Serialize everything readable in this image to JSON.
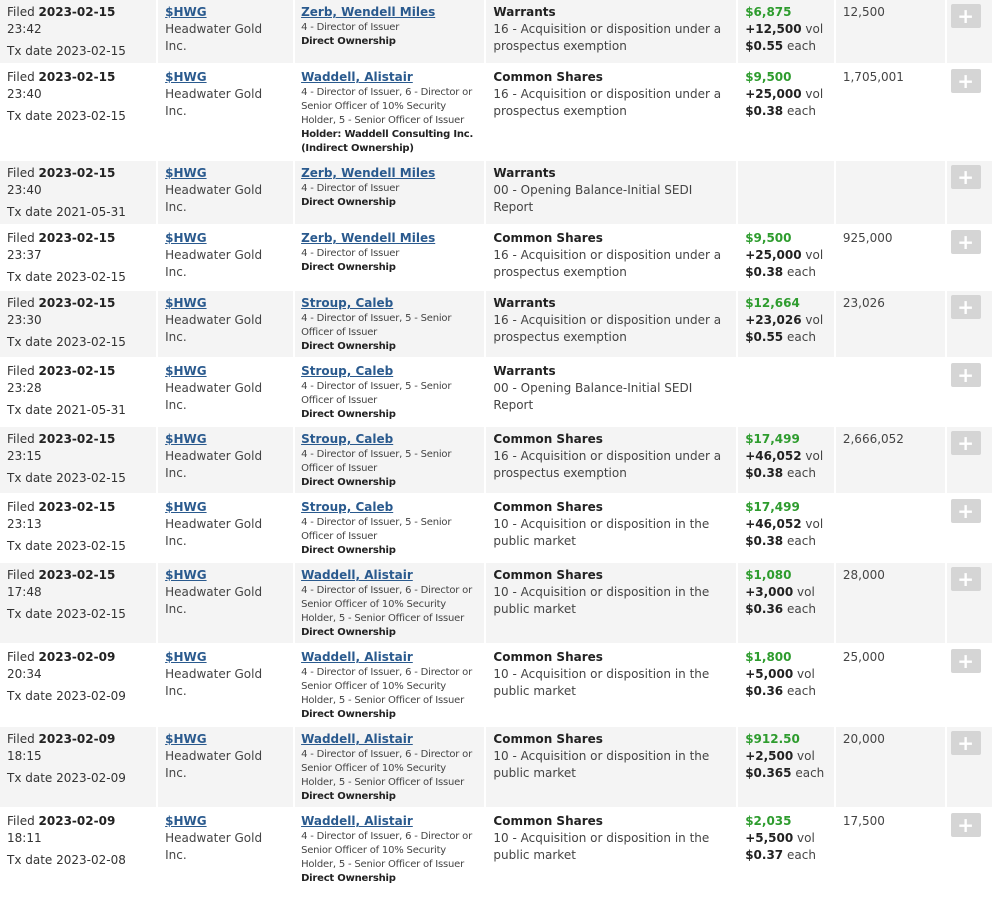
{
  "labels": {
    "filed": "Filed",
    "tx_date": "Tx date",
    "vol": "vol",
    "each": "each"
  },
  "add_button_label": "+",
  "colors": {
    "value_green": "#2e9c2e",
    "link_blue": "#2a5a8e",
    "button_grey": "#d5d5d5"
  },
  "rows": [
    {
      "filed_date": "2023-02-15",
      "filed_time": "23:42",
      "tx_date": "2023-02-15",
      "ticker": "$HWG",
      "issuer": "Headwater Gold Inc.",
      "insider": "Zerb, Wendell Miles",
      "relation": "4 - Director of Issuer",
      "holder": "",
      "ownership": "Direct Ownership",
      "security": "Warrants",
      "nature": "16 - Acquisition or disposition under a prospectus exemption",
      "value": "$6,875",
      "volume": "+12,500",
      "price": "$0.55",
      "holdings": "12,500"
    },
    {
      "filed_date": "2023-02-15",
      "filed_time": "23:40",
      "tx_date": "2023-02-15",
      "ticker": "$HWG",
      "issuer": "Headwater Gold Inc.",
      "insider": "Waddell, Alistair",
      "relation": "4 - Director of Issuer, 6 - Director or Senior Officer of 10% Security Holder, 5 - Senior Officer of Issuer",
      "holder": "Holder: Waddell Consulting Inc.",
      "ownership": "(Indirect Ownership)",
      "security": "Common Shares",
      "nature": "16 - Acquisition or disposition under a prospectus exemption",
      "value": "$9,500",
      "volume": "+25,000",
      "price": "$0.38",
      "holdings": "1,705,001"
    },
    {
      "filed_date": "2023-02-15",
      "filed_time": "23:40",
      "tx_date": "2021-05-31",
      "ticker": "$HWG",
      "issuer": "Headwater Gold Inc.",
      "insider": "Zerb, Wendell Miles",
      "relation": "4 - Director of Issuer",
      "holder": "",
      "ownership": "Direct Ownership",
      "security": "Warrants",
      "nature": "00 - Opening Balance-Initial SEDI Report",
      "value": "",
      "volume": "",
      "price": "",
      "holdings": ""
    },
    {
      "filed_date": "2023-02-15",
      "filed_time": "23:37",
      "tx_date": "2023-02-15",
      "ticker": "$HWG",
      "issuer": "Headwater Gold Inc.",
      "insider": "Zerb, Wendell Miles",
      "relation": "4 - Director of Issuer",
      "holder": "",
      "ownership": "Direct Ownership",
      "security": "Common Shares",
      "nature": "16 - Acquisition or disposition under a prospectus exemption",
      "value": "$9,500",
      "volume": "+25,000",
      "price": "$0.38",
      "holdings": "925,000"
    },
    {
      "filed_date": "2023-02-15",
      "filed_time": "23:30",
      "tx_date": "2023-02-15",
      "ticker": "$HWG",
      "issuer": "Headwater Gold Inc.",
      "insider": "Stroup, Caleb",
      "relation": "4 - Director of Issuer, 5 - Senior Officer of Issuer",
      "holder": "",
      "ownership": "Direct Ownership",
      "security": "Warrants",
      "nature": "16 - Acquisition or disposition under a prospectus exemption",
      "value": "$12,664",
      "volume": "+23,026",
      "price": "$0.55",
      "holdings": "23,026"
    },
    {
      "filed_date": "2023-02-15",
      "filed_time": "23:28",
      "tx_date": "2021-05-31",
      "ticker": "$HWG",
      "issuer": "Headwater Gold Inc.",
      "insider": "Stroup, Caleb",
      "relation": "4 - Director of Issuer, 5 - Senior Officer of Issuer",
      "holder": "",
      "ownership": "Direct Ownership",
      "security": "Warrants",
      "nature": "00 - Opening Balance-Initial SEDI Report",
      "value": "",
      "volume": "",
      "price": "",
      "holdings": ""
    },
    {
      "filed_date": "2023-02-15",
      "filed_time": "23:15",
      "tx_date": "2023-02-15",
      "ticker": "$HWG",
      "issuer": "Headwater Gold Inc.",
      "insider": "Stroup, Caleb",
      "relation": "4 - Director of Issuer, 5 - Senior Officer of Issuer",
      "holder": "",
      "ownership": "Direct Ownership",
      "security": "Common Shares",
      "nature": "16 - Acquisition or disposition under a prospectus exemption",
      "value": "$17,499",
      "volume": "+46,052",
      "price": "$0.38",
      "holdings": "2,666,052"
    },
    {
      "filed_date": "2023-02-15",
      "filed_time": "23:13",
      "tx_date": "2023-02-15",
      "ticker": "$HWG",
      "issuer": "Headwater Gold Inc.",
      "insider": "Stroup, Caleb",
      "relation": "4 - Director of Issuer, 5 - Senior Officer of Issuer",
      "holder": "",
      "ownership": "Direct Ownership",
      "security": "Common Shares",
      "nature": "10 - Acquisition or disposition in the public market",
      "value": "$17,499",
      "volume": "+46,052",
      "price": "$0.38",
      "holdings": ""
    },
    {
      "filed_date": "2023-02-15",
      "filed_time": "17:48",
      "tx_date": "2023-02-15",
      "ticker": "$HWG",
      "issuer": "Headwater Gold Inc.",
      "insider": "Waddell, Alistair",
      "relation": "4 - Director of Issuer, 6 - Director or Senior Officer of 10% Security Holder, 5 - Senior Officer of Issuer",
      "holder": "",
      "ownership": "Direct Ownership",
      "security": "Common Shares",
      "nature": "10 - Acquisition or disposition in the public market",
      "value": "$1,080",
      "volume": "+3,000",
      "price": "$0.36",
      "holdings": "28,000"
    },
    {
      "filed_date": "2023-02-09",
      "filed_time": "20:34",
      "tx_date": "2023-02-09",
      "ticker": "$HWG",
      "issuer": "Headwater Gold Inc.",
      "insider": "Waddell, Alistair",
      "relation": "4 - Director of Issuer, 6 - Director or Senior Officer of 10% Security Holder, 5 - Senior Officer of Issuer",
      "holder": "",
      "ownership": "Direct Ownership",
      "security": "Common Shares",
      "nature": "10 - Acquisition or disposition in the public market",
      "value": "$1,800",
      "volume": "+5,000",
      "price": "$0.36",
      "holdings": "25,000"
    },
    {
      "filed_date": "2023-02-09",
      "filed_time": "18:15",
      "tx_date": "2023-02-09",
      "ticker": "$HWG",
      "issuer": "Headwater Gold Inc.",
      "insider": "Waddell, Alistair",
      "relation": "4 - Director of Issuer, 6 - Director or Senior Officer of 10% Security Holder, 5 - Senior Officer of Issuer",
      "holder": "",
      "ownership": "Direct Ownership",
      "security": "Common Shares",
      "nature": "10 - Acquisition or disposition in the public market",
      "value": "$912.50",
      "volume": "+2,500",
      "price": "$0.365",
      "holdings": "20,000"
    },
    {
      "filed_date": "2023-02-09",
      "filed_time": "18:11",
      "tx_date": "2023-02-08",
      "ticker": "$HWG",
      "issuer": "Headwater Gold Inc.",
      "insider": "Waddell, Alistair",
      "relation": "4 - Director of Issuer, 6 - Director or Senior Officer of 10% Security Holder, 5 - Senior Officer of Issuer",
      "holder": "",
      "ownership": "Direct Ownership",
      "security": "Common Shares",
      "nature": "10 - Acquisition or disposition in the public market",
      "value": "$2,035",
      "volume": "+5,500",
      "price": "$0.37",
      "holdings": "17,500"
    }
  ]
}
